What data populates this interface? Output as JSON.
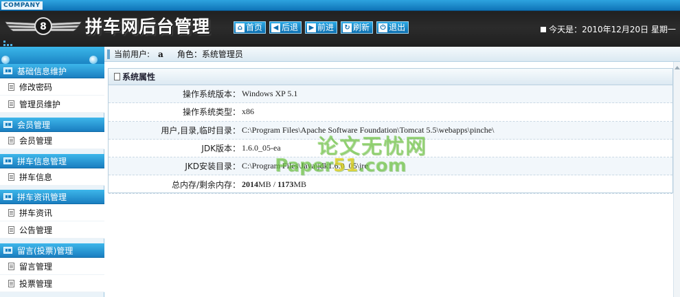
{
  "header": {
    "company_tag": "COMPANY",
    "site_title": "拼车网后台管理",
    "nav_buttons": [
      {
        "icon": "home-icon",
        "glyph": "⌂",
        "label": "首页"
      },
      {
        "icon": "back-icon",
        "glyph": "◀",
        "label": "后退"
      },
      {
        "icon": "forward-icon",
        "glyph": "▶",
        "label": "前进"
      },
      {
        "icon": "refresh-icon",
        "glyph": "↻",
        "label": "刷新"
      },
      {
        "icon": "power-icon",
        "glyph": "⏻",
        "label": "退出"
      }
    ],
    "date_text": "今天是：2010年12月20日  星期一"
  },
  "sidebar": {
    "groups": [
      {
        "title": "基础信息维护",
        "items": [
          "修改密码",
          "管理员维护"
        ]
      },
      {
        "title": "会员管理",
        "items": [
          "会员管理"
        ]
      },
      {
        "title": "拼车信息管理",
        "items": [
          "拼车信息"
        ]
      },
      {
        "title": "拼车资讯管理",
        "items": [
          "拼车资讯",
          "公告管理"
        ]
      },
      {
        "title": "留言(投票)管理",
        "items": [
          "留言管理",
          "投票管理"
        ]
      }
    ]
  },
  "userbar": {
    "user_label": "当前用户:",
    "user_value": "a",
    "role_label": "角色：系统管理员"
  },
  "panel": {
    "title": "系统属性",
    "rows": [
      {
        "key": "操作系统版本：",
        "value": "Windows XP  5.1"
      },
      {
        "key": "操作系统类型：",
        "value": "x86"
      },
      {
        "key": "用户,目录,临时目录：",
        "value": "C:\\Program Files\\Apache Software Foundation\\Tomcat 5.5\\webapps\\pinche\\"
      },
      {
        "key": "JDK版本：",
        "value": "1.6.0_05-ea"
      },
      {
        "key": "JKD安装目录：",
        "value": "C:\\Program Files\\Java\\jdk1.6.0_05\\jre"
      }
    ],
    "memory": {
      "key": "总内存/剩余内存：",
      "total": "2014",
      "free": "1173",
      "unit": "MB",
      "sep": " / "
    }
  },
  "watermark": {
    "line1": "论文无忧网",
    "line2_a": "Paper",
    "line2_b": "51",
    "line2_c": ".com"
  }
}
